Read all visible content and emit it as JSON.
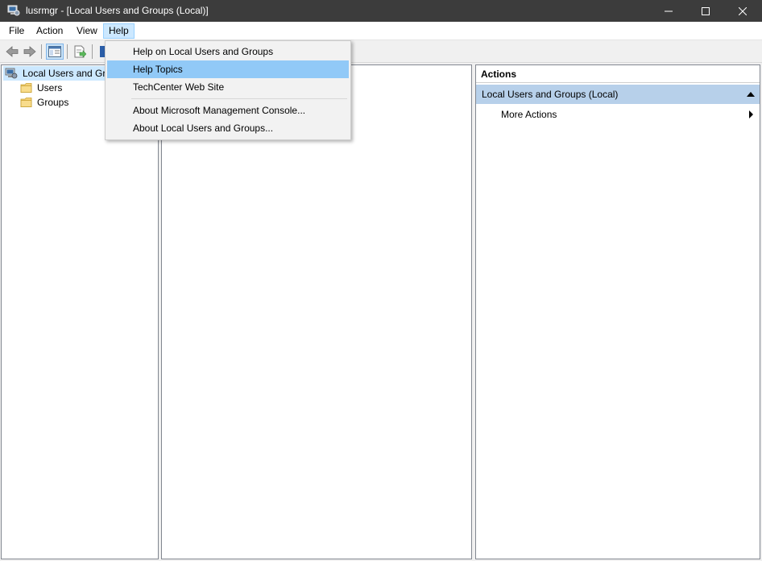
{
  "window": {
    "title": "lusrmgr - [Local Users and Groups (Local)]"
  },
  "menubar": {
    "items": [
      "File",
      "Action",
      "View",
      "Help"
    ],
    "active": "Help"
  },
  "help_menu": {
    "items": [
      "Help on Local Users and Groups",
      "Help Topics",
      "TechCenter Web Site",
      "About Microsoft Management Console...",
      "About Local Users and Groups..."
    ],
    "highlighted": "Help Topics"
  },
  "tree": {
    "root": "Local Users and Groups (Local)",
    "children": [
      "Users",
      "Groups"
    ]
  },
  "actions": {
    "header": "Actions",
    "group": "Local Users and Groups (Local)",
    "items": [
      "More Actions"
    ]
  },
  "icons": {
    "app": "computer-management-icon",
    "folder": "folder-icon",
    "back": "back-arrow-icon",
    "forward": "forward-arrow-icon",
    "show_hide_tree": "console-tree-icon",
    "export": "export-list-icon",
    "help": "help-icon"
  },
  "colors": {
    "titlebar": "#3c3c3c",
    "menu_active": "#cce8ff",
    "menu_highlight": "#91c9f7",
    "actions_group": "#b7d0ea",
    "tree_selected": "#cce8ff"
  }
}
